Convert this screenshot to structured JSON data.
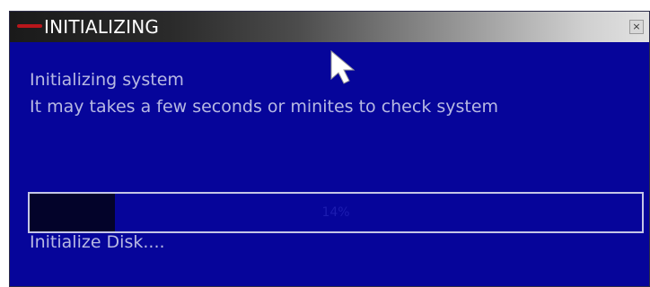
{
  "dialog": {
    "title": "INITIALIZING",
    "close_label": "×",
    "message_line1": "Initializing system",
    "message_line2": "It may takes a few seconds or minites to check system",
    "progress_percent": 14,
    "progress_text": "14%",
    "status_text": "Initialize Disk...."
  },
  "colors": {
    "dialog_bg": "#06059a",
    "text": "#b7b9e2",
    "progress_fill": "#03032a",
    "title_accent": "#b8161b"
  },
  "icons": {
    "cursor": "mouse-pointer-icon",
    "close": "close-icon"
  }
}
